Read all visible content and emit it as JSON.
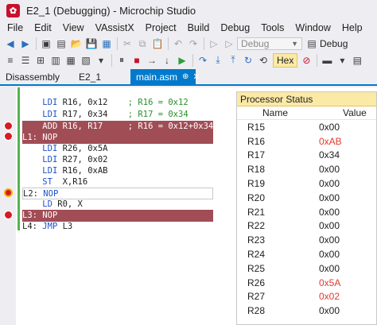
{
  "window": {
    "title": "E2_1 (Debugging) - Microchip Studio"
  },
  "menu": [
    "File",
    "Edit",
    "View",
    "VAssistX",
    "Project",
    "Build",
    "Debug",
    "Tools",
    "Window",
    "Help"
  ],
  "toolbar": {
    "config_dropdown": "Debug",
    "hex_label": "Hex"
  },
  "tabs": {
    "disassembly": "Disassembly",
    "e2_1": "E2_1",
    "main_asm": "main.asm"
  },
  "code": {
    "l1": {
      "ins": "LDI",
      "args": " R16, 0x12    ",
      "comment": "; R16 = 0x12"
    },
    "l2": {
      "ins": "LDI",
      "args": " R17, 0x34    ",
      "comment": "; R17 = 0x34"
    },
    "l3": {
      "ins": "ADD",
      "args": " R16, R17     ",
      "comment": "; R16 = 0x12+0x34"
    },
    "l4": {
      "label": "L1:",
      "ins": "NOP"
    },
    "l5": {
      "ins": "LDI",
      "args": " R26, 0x5A"
    },
    "l6": {
      "ins": "LDI",
      "args": " R27, 0x02"
    },
    "l7": {
      "ins": "LDI",
      "args": " R16, 0xAB"
    },
    "l8": {
      "ins": "ST",
      "args": "  X,R16"
    },
    "l9": {
      "label": "L2:",
      "ins": "NOP"
    },
    "l10": {
      "ins": "LD",
      "args": " R0, X"
    },
    "l11": {
      "label": "L3:",
      "ins": "NOP"
    },
    "l12": {
      "label": "L4:",
      "ins": "JMP",
      "args": " L3"
    }
  },
  "processor_status": {
    "title": "Processor Status",
    "col_name": "Name",
    "col_value": "Value",
    "registers": [
      {
        "name": "R15",
        "value": "0x00",
        "changed": false
      },
      {
        "name": "R16",
        "value": "0xAB",
        "changed": true
      },
      {
        "name": "R17",
        "value": "0x34",
        "changed": false
      },
      {
        "name": "R18",
        "value": "0x00",
        "changed": false
      },
      {
        "name": "R19",
        "value": "0x00",
        "changed": false
      },
      {
        "name": "R20",
        "value": "0x00",
        "changed": false
      },
      {
        "name": "R21",
        "value": "0x00",
        "changed": false
      },
      {
        "name": "R22",
        "value": "0x00",
        "changed": false
      },
      {
        "name": "R23",
        "value": "0x00",
        "changed": false
      },
      {
        "name": "R24",
        "value": "0x00",
        "changed": false
      },
      {
        "name": "R25",
        "value": "0x00",
        "changed": false
      },
      {
        "name": "R26",
        "value": "0x5A",
        "changed": true
      },
      {
        "name": "R27",
        "value": "0x02",
        "changed": true
      },
      {
        "name": "R28",
        "value": "0x00",
        "changed": false
      }
    ]
  },
  "colors": {
    "breakpoint": "#d51b26",
    "breakpoint_line": "#a14d56",
    "accent": "#007acc",
    "changed_value": "#e03c31"
  }
}
